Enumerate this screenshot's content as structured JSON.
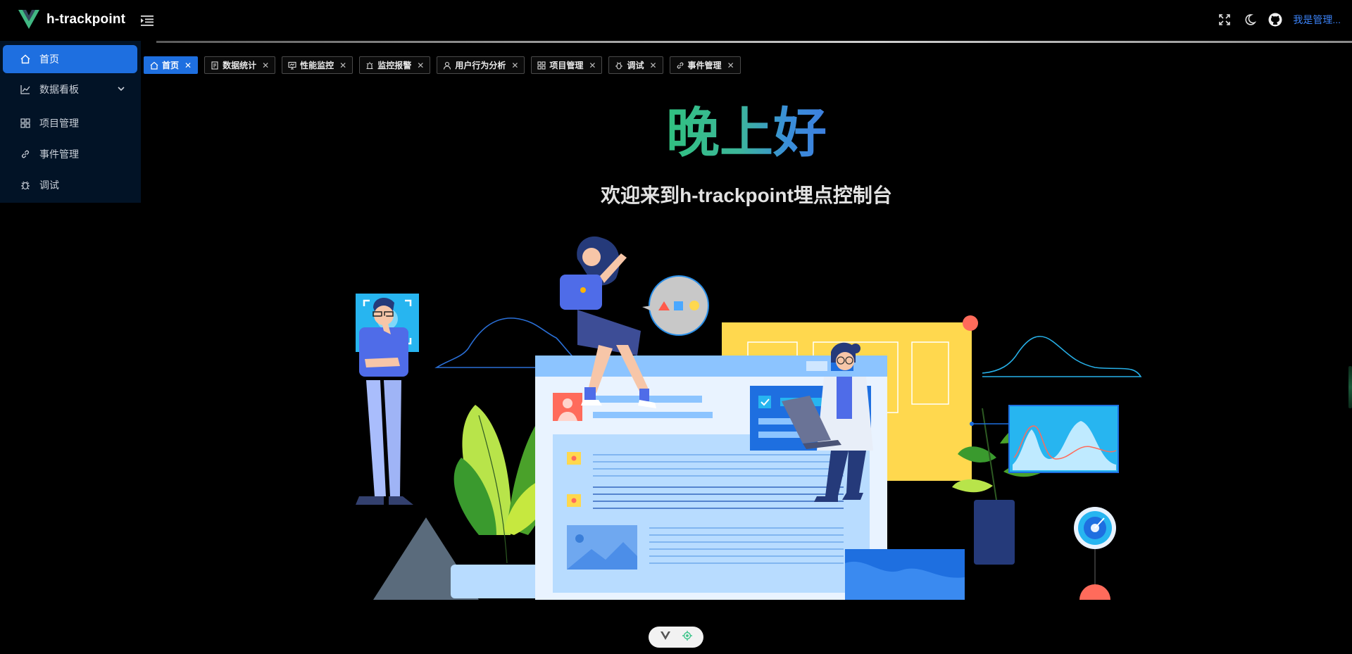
{
  "app": {
    "name": "h-trackpoint"
  },
  "header": {
    "user_name": "我是管理..."
  },
  "sidebar": {
    "items": [
      {
        "label": "首页",
        "icon": "home-icon",
        "active": true
      },
      {
        "label": "数据看板",
        "icon": "chart-line-icon",
        "expandable": true
      },
      {
        "label": "项目管理",
        "icon": "grid-icon"
      },
      {
        "label": "事件管理",
        "icon": "link-icon"
      },
      {
        "label": "调试",
        "icon": "bug-icon"
      }
    ]
  },
  "tabs": [
    {
      "label": "首页",
      "icon": "home-icon",
      "active": true
    },
    {
      "label": "数据统计",
      "icon": "document-icon"
    },
    {
      "label": "性能监控",
      "icon": "monitor-icon"
    },
    {
      "label": "监控报警",
      "icon": "alarm-icon"
    },
    {
      "label": "用户行为分析",
      "icon": "user-icon"
    },
    {
      "label": "项目管理",
      "icon": "grid-icon"
    },
    {
      "label": "调试",
      "icon": "bug-icon"
    },
    {
      "label": "事件管理",
      "icon": "link-icon"
    }
  ],
  "main": {
    "greeting": "晚上好",
    "welcome": "欢迎来到h-trackpoint埋点控制台"
  },
  "colors": {
    "accent": "#1e6fe0",
    "sidebar_bg": "#021326",
    "greeting_start": "#30c080",
    "greeting_end": "#3a8fd8",
    "user_link": "#3b82f6"
  }
}
